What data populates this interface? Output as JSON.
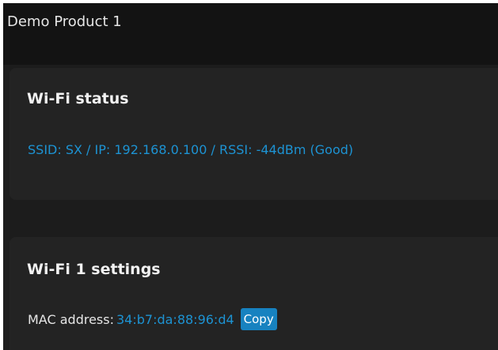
{
  "header": {
    "product_title": "Demo Product 1"
  },
  "wifi_status": {
    "title": "Wi-Fi status",
    "status_text": "SSID: SX / IP: 192.168.0.100 / RSSI: -44dBm (Good)"
  },
  "wifi1_settings": {
    "title": "Wi-Fi 1 settings",
    "mac_label": "MAC address:",
    "mac_value": "34:b7:da:88:96:d4",
    "copy_label": "Copy"
  },
  "colors": {
    "background": "#1c1c1c",
    "header_background": "#131313",
    "card_background": "#232323",
    "link_blue": "#1d93d3",
    "button_blue": "#1782c0",
    "text": "#e6e6e6"
  }
}
